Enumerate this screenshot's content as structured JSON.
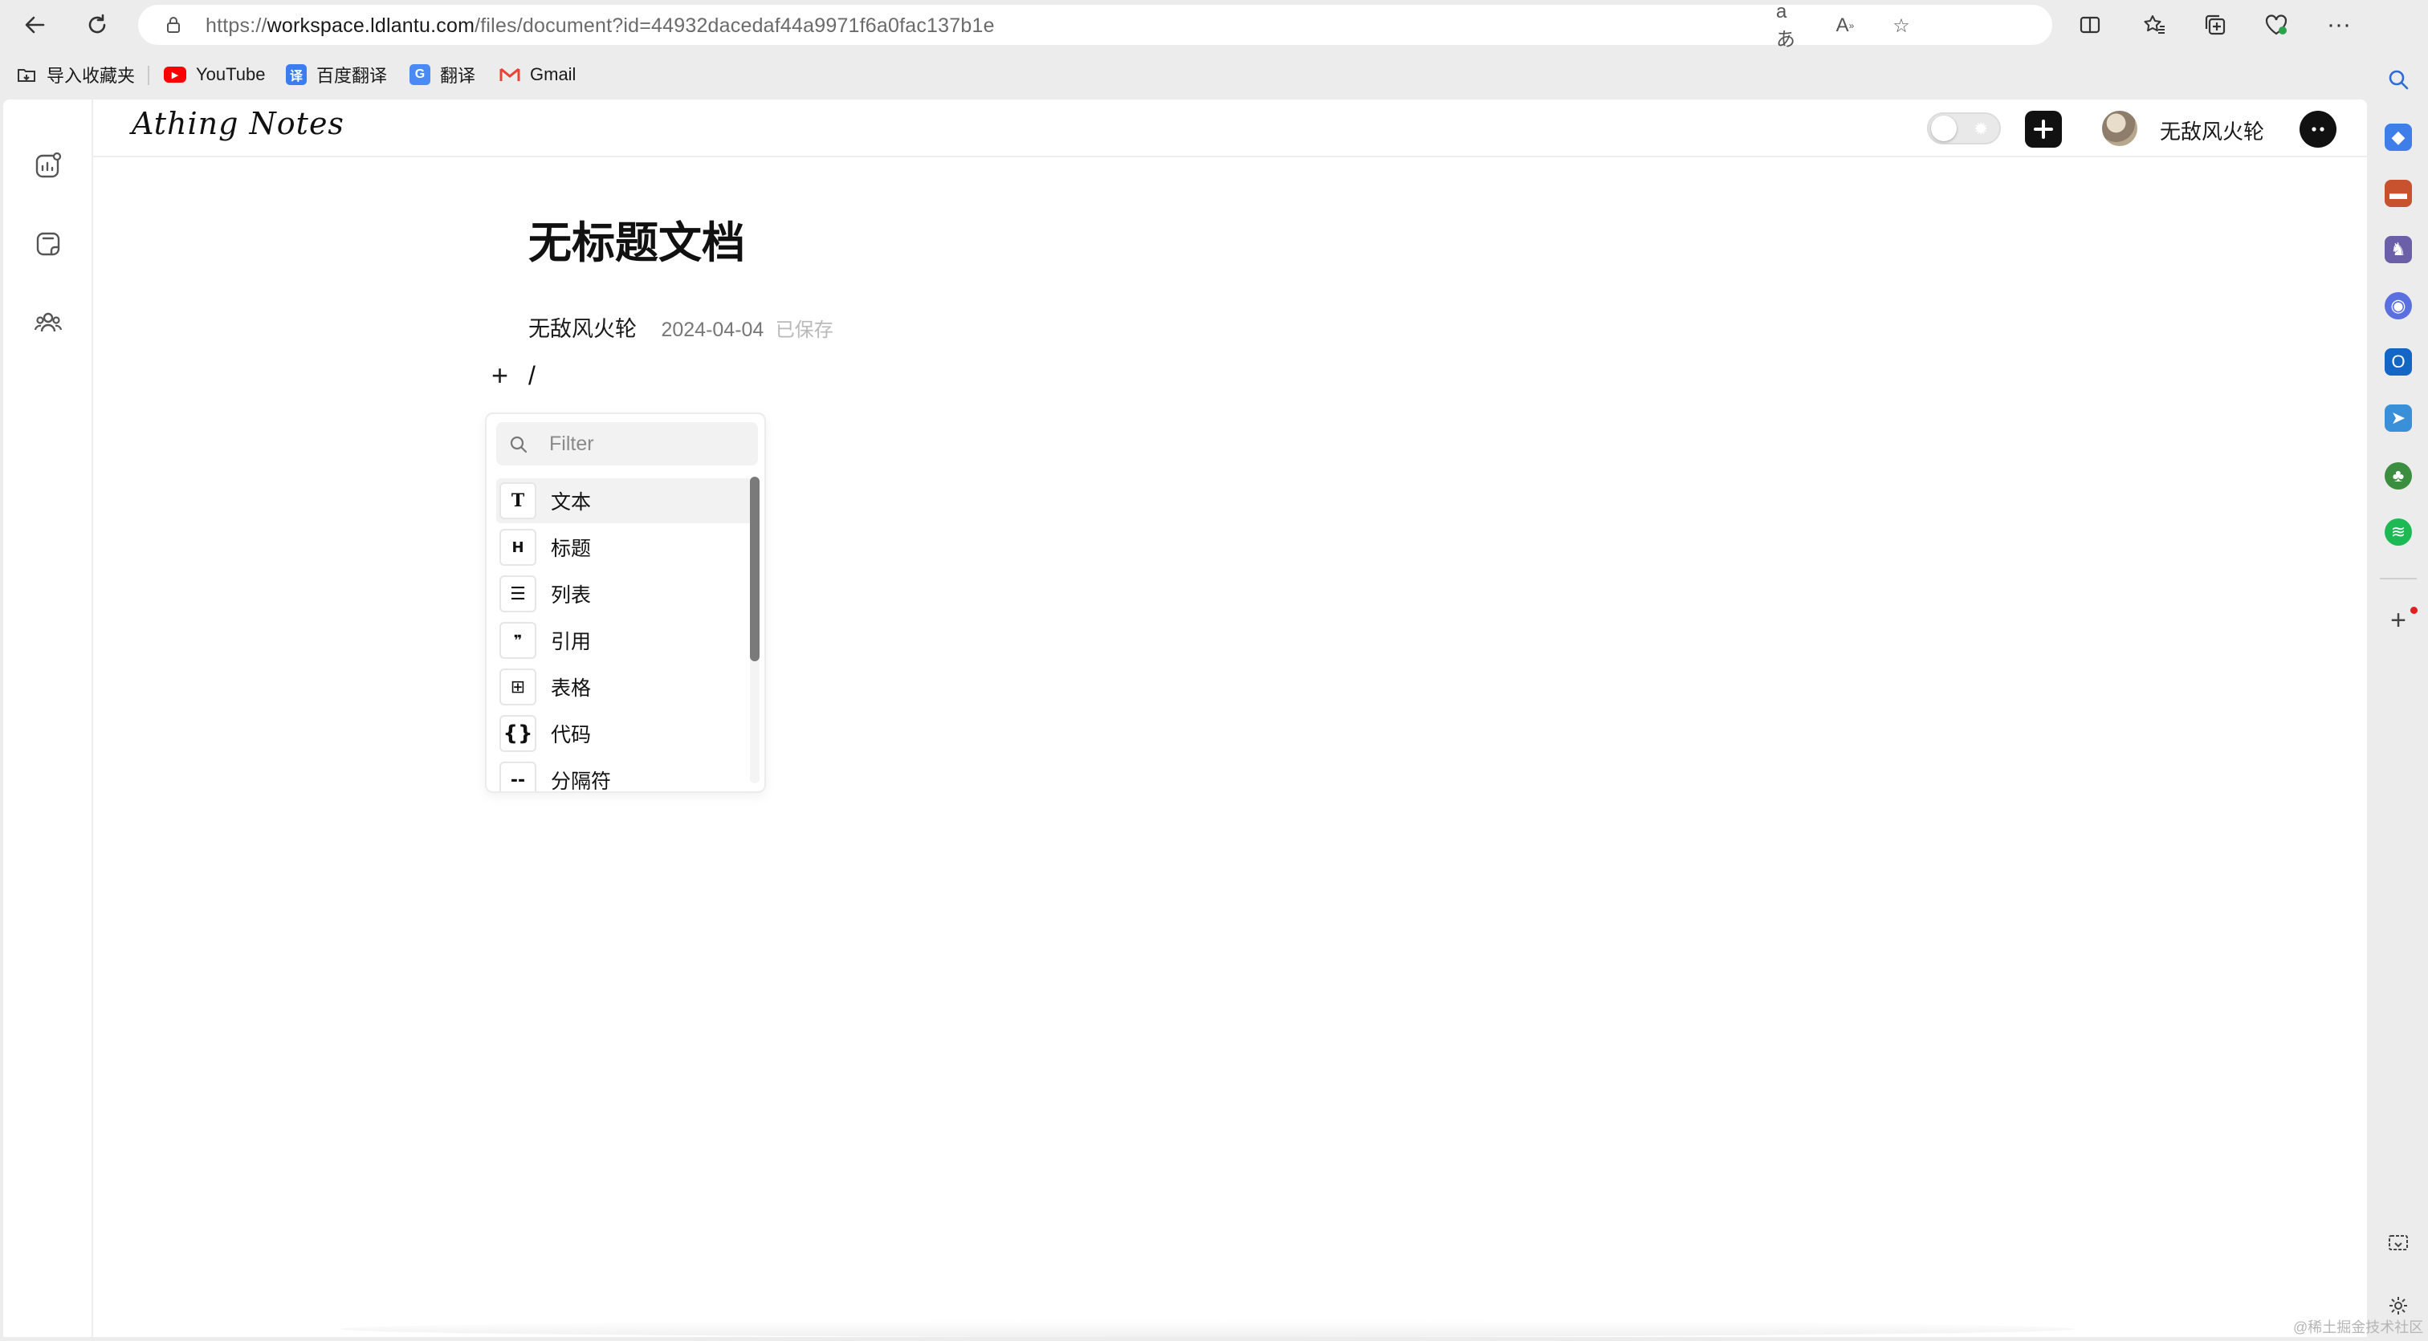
{
  "browser": {
    "url_scheme": "https://",
    "url_host": "workspace.ldlantu.com",
    "url_path": "/files/document?id=44932dacedaf44a9971f6a0fac137b1e",
    "icons": [
      "back-icon",
      "reload-icon",
      "lock-icon",
      "translate-icon",
      "read-aloud-icon",
      "favorite-star-icon",
      "split-screen-icon",
      "favorites-icon",
      "collections-icon",
      "browser-essentials-icon",
      "more-icon"
    ]
  },
  "bookmarks": [
    {
      "label": "导入收藏夹",
      "icon": "import-folder-icon"
    },
    {
      "label": "YouTube",
      "icon": "youtube-icon"
    },
    {
      "label": "百度翻译",
      "icon": "baidu-translate-icon"
    },
    {
      "label": "翻译",
      "icon": "google-translate-icon"
    },
    {
      "label": "Gmail",
      "icon": "gmail-icon"
    }
  ],
  "app": {
    "brand": "Athing Notes",
    "user_name": "无敌风火轮",
    "theme_toggle_icon": "sun-icon"
  },
  "document": {
    "title": "无标题文档",
    "author": "无敌风火轮",
    "date": "2024-04-04",
    "save_status": "已保存",
    "block_add": "+",
    "current_input": "/"
  },
  "slash_menu": {
    "filter_placeholder": "Filter",
    "items": [
      {
        "label": "文本",
        "icon": "T",
        "active": true
      },
      {
        "label": "标题",
        "icon": "H"
      },
      {
        "label": "列表",
        "icon": "☰"
      },
      {
        "label": "引用",
        "icon": "❞"
      },
      {
        "label": "表格",
        "icon": "⊞"
      },
      {
        "label": "代码",
        "icon": "{}"
      },
      {
        "label": "分隔符",
        "icon": "--"
      }
    ]
  },
  "watermark": "@稀土掘金技术社区",
  "colors": {
    "chrome_bg": "#ececec",
    "page_bg": "#ffffff",
    "accent_dark": "#111111",
    "muted_text": "#777777"
  }
}
